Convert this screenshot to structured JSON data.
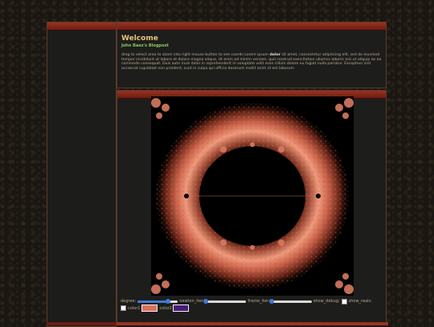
{
  "welcome": {
    "title": "Welcome",
    "subtitle": "John Baez's Blogpost",
    "desc_pre": "drag to select area to zoom into right mouse button to see coords Lorem ipsum ",
    "desc_bold": "dolor",
    "desc_post": " sit amet, consectetur adipiscing elit, sed do eiusmod tempor incididunt ut labore et dolore magna aliqua. Ut enim ad minim veniam, quis nostrud exercitation ullamco laboris nisi ut aliquip ex ea commodo consequat. Duis aute irure dolor in reprehenderit in voluptate velit esse cillum dolore eu fugiat nulla pariatur. Excepteur sint occaecat cupidatat non proident, sunt in culpa qui officia deserunt mollit anim id est laborum"
  },
  "controls": {
    "degree_label": "degree:",
    "degree_level": 0.75,
    "newton_label": "newton_iter:",
    "newton_level": 0.0,
    "frame_label": "frame_iter:",
    "frame_level": 0.0,
    "show_debug_label": "show_debug:",
    "show_reals_label": "show_reals:",
    "color1_label": "color1",
    "color1": "#e0705a",
    "color2_label": "color2",
    "color2": "#4a1a7a"
  },
  "colors": {
    "accent_bar": "#8a2a1c",
    "title": "#e8c27a",
    "subtitle": "#8fc860",
    "fractal": "#e48a70"
  }
}
